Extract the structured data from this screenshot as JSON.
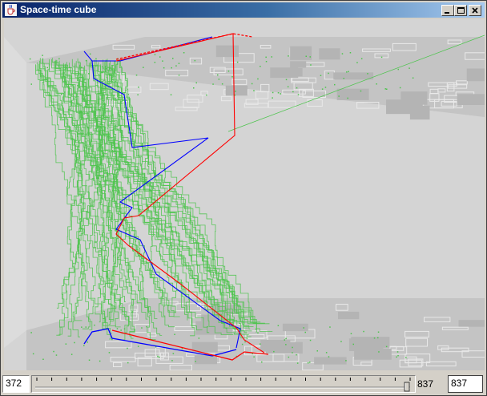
{
  "window": {
    "title": "Space-time cube",
    "app_icon": "java-cup-icon",
    "controls": [
      "minimize-icon",
      "maximize-icon",
      "close-icon"
    ]
  },
  "scene": {
    "background": "#d4d4d4",
    "floor_color": "#c2c2c2",
    "map_line_color": "#e9e9e9",
    "trajectory_colors": {
      "others": "#4cc44c",
      "highlight_a": "#0000ff",
      "highlight_b": "#ff0000"
    },
    "trajectory_count": 60
  },
  "time_slider": {
    "min_value": "372",
    "max_value": "837",
    "current_value": "837",
    "position": 1.0
  }
}
